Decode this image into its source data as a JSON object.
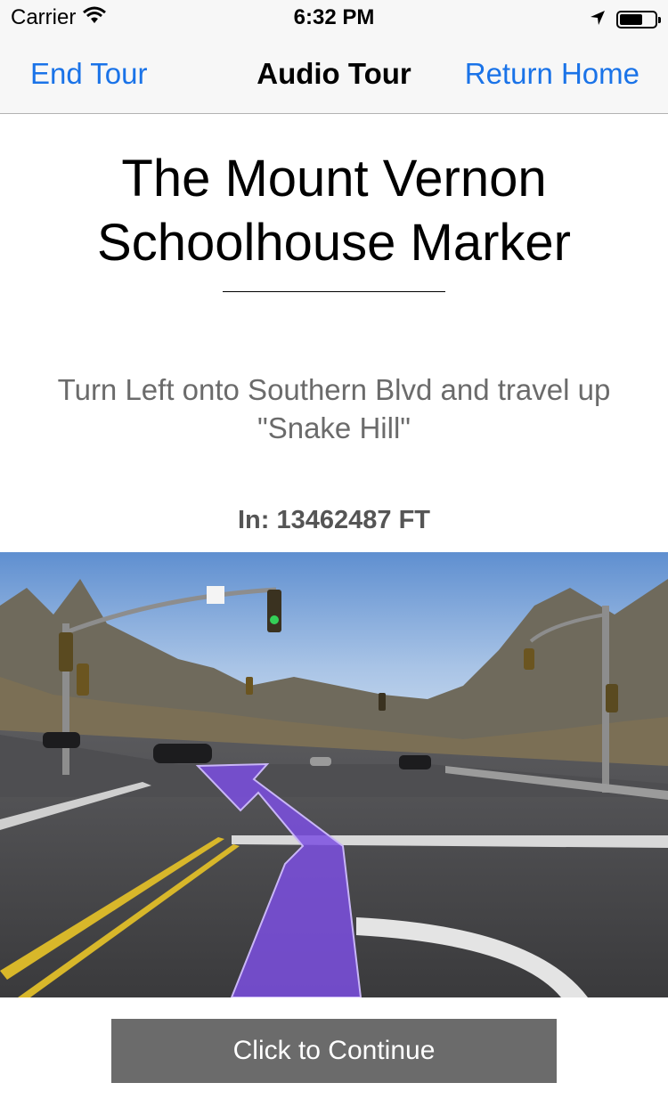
{
  "status_bar": {
    "carrier": "Carrier",
    "time": "6:32 PM"
  },
  "nav": {
    "left": "End Tour",
    "title": "Audio Tour",
    "right": "Return Home"
  },
  "stop": {
    "title": "The Mount Vernon Schoolhouse Marker",
    "instruction": "Turn Left onto Southern Blvd and travel up \"Snake Hill\"",
    "distance": "In: 13462487 FT"
  },
  "continue_button": "Click to Continue",
  "icons": [
    "wifi-icon",
    "location-arrow-icon",
    "battery-icon",
    "turn-left-arrow-icon"
  ],
  "colors": {
    "link": "#1a73e8",
    "button": "#6b6b6b",
    "arrow": "#7b4fe0"
  }
}
